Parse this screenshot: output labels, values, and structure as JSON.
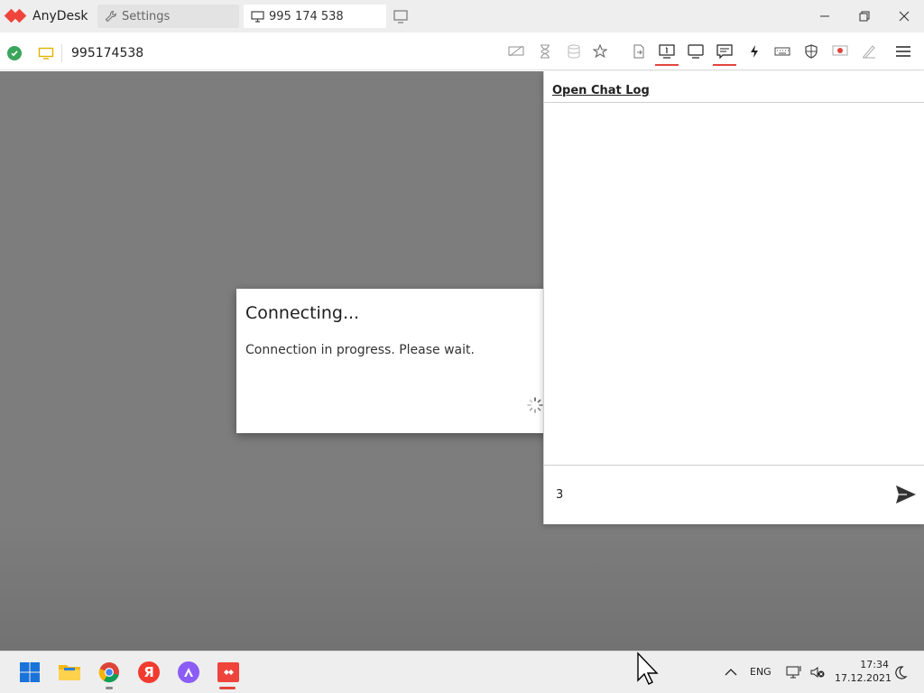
{
  "app": {
    "name": "AnyDesk"
  },
  "tabs": [
    {
      "label": "Settings",
      "icon": "wrench-icon"
    },
    {
      "label": "995 174 538",
      "icon": "monitor-icon"
    }
  ],
  "toolbar": {
    "status": "connected",
    "address": "995174538",
    "accent_color": "#e2443c",
    "buttons": [
      "privacy-mode-icon",
      "hourglass-icon",
      "database-icon",
      "favorite-star-icon",
      "file-transfer-icon",
      "switch-monitor-icon",
      "display-icon",
      "chat-icon",
      "actions-lightning-icon",
      "keyboard-icon",
      "permissions-shield-icon",
      "record-icon",
      "whiteboard-pen-icon",
      "menu-icon"
    ]
  },
  "dialog": {
    "title": "Connecting...",
    "message": "Connection in progress. Please wait."
  },
  "chat": {
    "open_log_label": "Open Chat Log",
    "input_value": "3"
  },
  "taskbar": {
    "language": "ENG",
    "time": "17:34",
    "date": "17.12.2021",
    "yandex_letter": "Я"
  }
}
